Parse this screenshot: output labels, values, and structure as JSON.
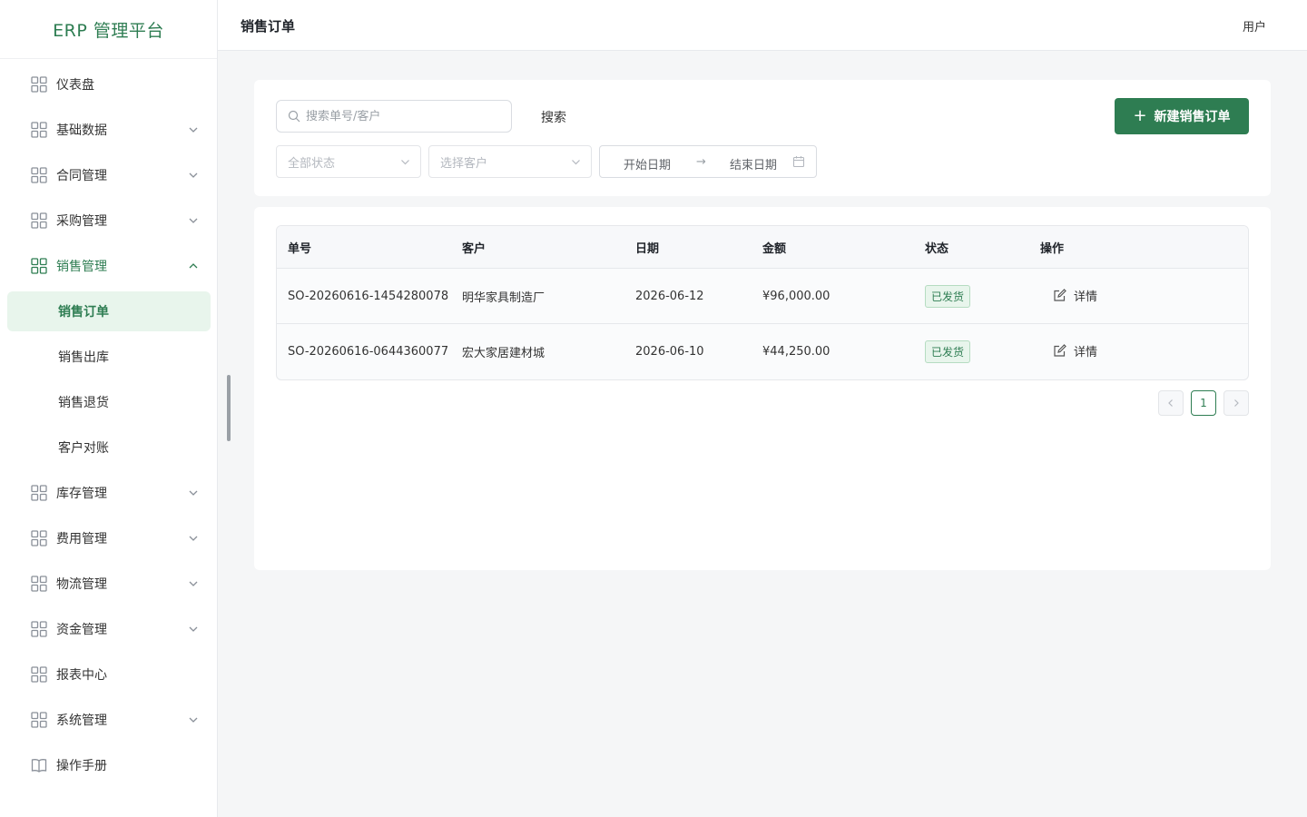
{
  "brand": "ERP 管理平台",
  "header": {
    "title": "销售订单",
    "user": "用户"
  },
  "sidebar": {
    "items": [
      {
        "label": "仪表盘"
      },
      {
        "label": "基础数据"
      },
      {
        "label": "合同管理"
      },
      {
        "label": "采购管理"
      },
      {
        "label": "销售管理"
      },
      {
        "label": "库存管理"
      },
      {
        "label": "费用管理"
      },
      {
        "label": "物流管理"
      },
      {
        "label": "资金管理"
      },
      {
        "label": "报表中心"
      },
      {
        "label": "系统管理"
      },
      {
        "label": "操作手册"
      }
    ],
    "sales_sub": [
      {
        "label": "销售订单"
      },
      {
        "label": "销售出库"
      },
      {
        "label": "销售退货"
      },
      {
        "label": "客户对账"
      }
    ]
  },
  "filters": {
    "search_placeholder": "搜索单号/客户",
    "search_button": "搜索",
    "new_button": "新建销售订单",
    "status_placeholder": "全部状态",
    "customer_placeholder": "选择客户",
    "start_date": "开始日期",
    "end_date": "结束日期"
  },
  "table": {
    "columns": [
      "单号",
      "客户",
      "日期",
      "金额",
      "状态",
      "操作"
    ],
    "rows": [
      {
        "no": "SO-20260616-1454280078",
        "customer": "明华家具制造厂",
        "date": "2026-06-12",
        "amount": "¥96,000.00",
        "status": "已发货",
        "action": "详情"
      },
      {
        "no": "SO-20260616-0644360077",
        "customer": "宏大家居建材城",
        "date": "2026-06-10",
        "amount": "¥44,250.00",
        "status": "已发货",
        "action": "详情"
      }
    ]
  },
  "pagination": {
    "current": "1"
  },
  "colors": {
    "accent": "#2e7d52",
    "accent_light": "#e8f5ec"
  }
}
